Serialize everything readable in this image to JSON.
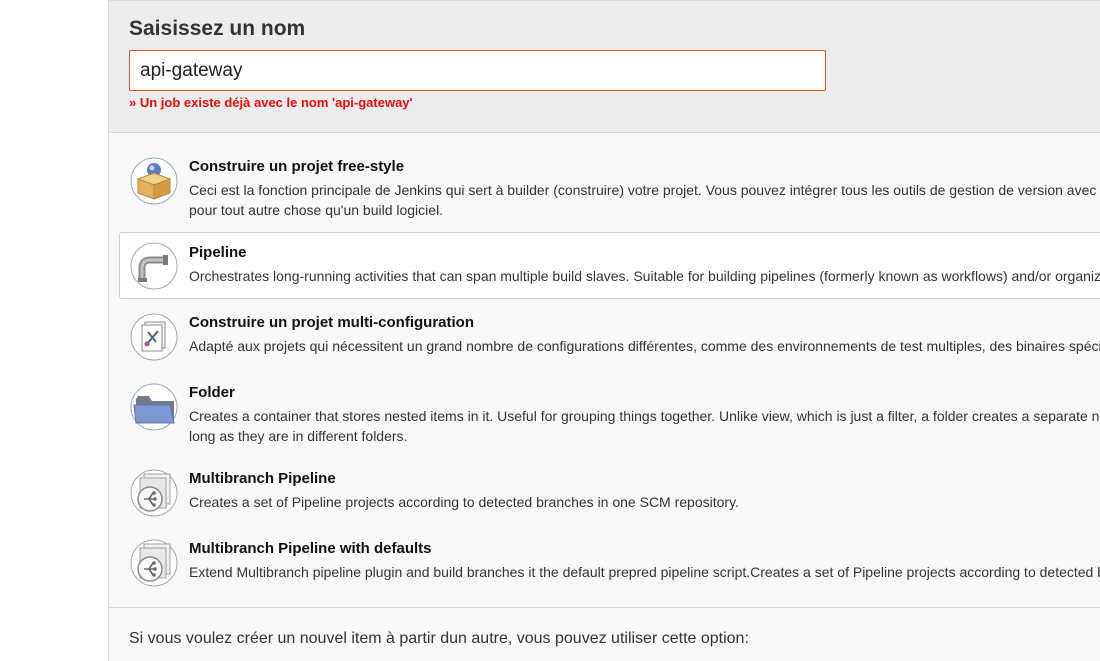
{
  "header": {
    "title": "Saisissez un nom",
    "name_value": "api-gateway",
    "error": "» Un job existe déjà avec le nom 'api-gateway'"
  },
  "items": [
    {
      "title": "Construire un projet free-style",
      "desc_line1": "Ceci est la fonction principale de Jenkins qui sert à builder (construire) votre projet. Vous pouvez intégrer tous les outils de gestion de version avec t",
      "desc_line2": "pour tout autre chose qu'un build logiciel.",
      "icon": "freestyle-package-icon",
      "selected": false
    },
    {
      "title": "Pipeline",
      "desc_line1": "Orchestrates long-running activities that can span multiple build slaves. Suitable for building pipelines (formerly known as workflows) and/or organiz",
      "desc_line2": "",
      "icon": "pipeline-icon",
      "selected": true
    },
    {
      "title": "Construire un projet multi-configuration",
      "desc_line1": "Adapté aux projets qui nécessitent un grand nombre de configurations différentes, comme des environnements de test multiples, des binaires spécif",
      "desc_line2": "",
      "icon": "multi-config-icon",
      "selected": false
    },
    {
      "title": "Folder",
      "desc_line1": "Creates a container that stores nested items in it. Useful for grouping things together. Unlike view, which is just a filter, a folder creates a separate na",
      "desc_line2": "long as they are in different folders.",
      "icon": "folder-icon",
      "selected": false
    },
    {
      "title": "Multibranch Pipeline",
      "desc_line1": "Creates a set of Pipeline projects according to detected branches in one SCM repository.",
      "desc_line2": "",
      "icon": "multibranch-pipeline-icon",
      "selected": false
    },
    {
      "title": "Multibranch Pipeline with defaults",
      "desc_line1": "Extend Multibranch pipeline plugin and build branches it the default prepred pipeline script.Creates a set of Pipeline projects according to detected b",
      "desc_line2": "",
      "icon": "multibranch-defaults-icon",
      "selected": false
    }
  ],
  "footer": {
    "copy_hint": "Si vous voulez créer un nouvel item à partir dun autre, vous pouvez utiliser cette option:"
  },
  "colors": {
    "error": "#e40d0d",
    "input_border": "#d9582b",
    "header_bg": "#ececec",
    "panel_bg": "#f8f8f8"
  }
}
